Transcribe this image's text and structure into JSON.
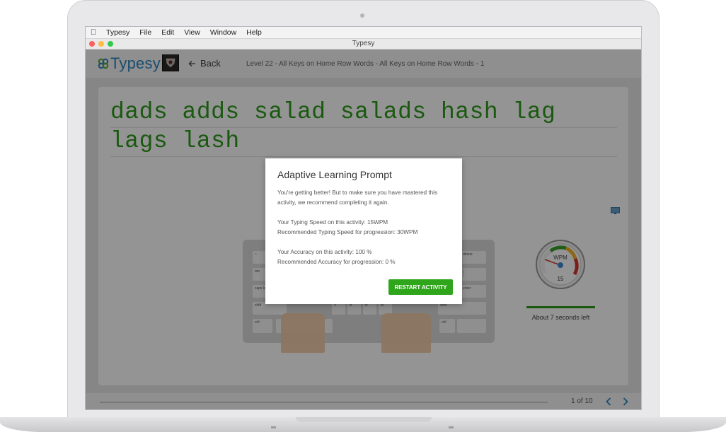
{
  "menubar": {
    "items": [
      "Typesy",
      "File",
      "Edit",
      "View",
      "Window",
      "Help"
    ]
  },
  "window": {
    "title": "Typesy"
  },
  "header": {
    "logo_text": "Typesy",
    "back_label": "Back",
    "breadcrumb": "Level 22 - All Keys on Home Row Words - All Keys on Home Row Words - 1"
  },
  "lesson": {
    "line1": "dads adds salad salads hash lag",
    "line2": "lags lash"
  },
  "keyboard": {
    "key_labels": [
      "~",
      "tab",
      "caps lock",
      "shift",
      "ctrl",
      "delete",
      "|",
      "\\",
      "enter",
      "shift",
      "V",
      "B",
      "N",
      "M",
      "ctrl"
    ]
  },
  "stats": {
    "gauge_label": "WPM",
    "wpm": "15",
    "time_left": "About 7 seconds left"
  },
  "footer": {
    "pager": "1 of 10"
  },
  "modal": {
    "title": "Adaptive Learning Prompt",
    "intro": "You're getting better! But to make sure you have mastered this activity, we recommend completing it again.",
    "typing_speed": "Your Typing Speed on this activity: 15WPM",
    "recommended_speed": "Recommended Typing Speed for progression: 30WPM",
    "accuracy": "Your Accuracy on this activity: 100 %",
    "recommended_accuracy": "Recommended Accuracy for progression: 0 %",
    "restart_label": "RESTART ACTIVITY"
  },
  "colors": {
    "accent_green": "#2fa51c",
    "text_green": "#2e9a1c",
    "brand_blue": "#2f86c2"
  }
}
